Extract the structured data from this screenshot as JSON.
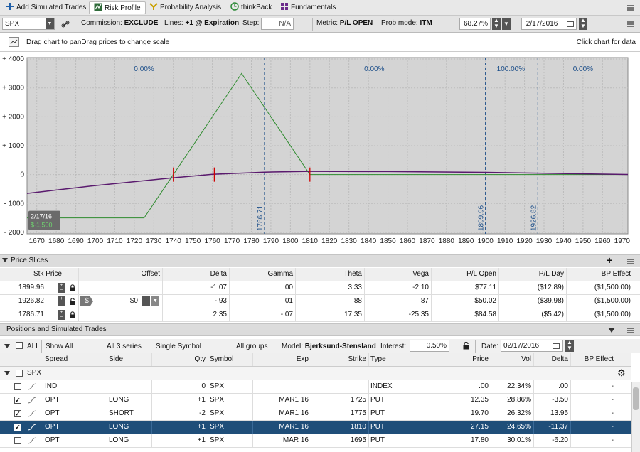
{
  "tabs": [
    {
      "label": "Add Simulated Trades",
      "icon": "plus-icon"
    },
    {
      "label": "Risk Profile",
      "icon": "risk-profile-icon",
      "active": true
    },
    {
      "label": "Probability Analysis",
      "icon": "probability-icon"
    },
    {
      "label": "thinkBack",
      "icon": "thinkback-icon"
    },
    {
      "label": "Fundamentals",
      "icon": "fundamentals-icon"
    }
  ],
  "toolbar": {
    "symbol": "SPX",
    "commission_label": "Commission:",
    "commission_value": "EXCLUDE",
    "lines_label": "Lines:",
    "lines_value": "+1 @ Expiration",
    "step_label": "Step:",
    "step_value": "N/A",
    "metric_label": "Metric:",
    "metric_value": "P/L OPEN",
    "prob_label": "Prob mode:",
    "prob_value": "ITM",
    "percent": "68.27%",
    "date": " 2/17/2016"
  },
  "infobar": {
    "left_text": "Drag chart to panDrag prices to change scale",
    "right_text": "Click chart for data"
  },
  "chart_data": {
    "type": "line",
    "xlim": [
      1665,
      1973
    ],
    "ylim": [
      -2050,
      4050
    ],
    "x_ticks": [
      1670,
      1680,
      1690,
      1700,
      1710,
      1720,
      1730,
      1740,
      1750,
      1760,
      1770,
      1780,
      1790,
      1800,
      1810,
      1820,
      1830,
      1840,
      1850,
      1860,
      1870,
      1880,
      1890,
      1900,
      1910,
      1920,
      1930,
      1940,
      1950,
      1960,
      1970
    ],
    "y_ticks": [
      {
        "v": 4000,
        "label": "+ 4000"
      },
      {
        "v": 3000,
        "label": "+ 3000"
      },
      {
        "v": 2000,
        "label": "+ 2000"
      },
      {
        "v": 1000,
        "label": "+ 1000"
      },
      {
        "v": 0,
        "label": "0"
      },
      {
        "v": -1000,
        "label": "- 1000"
      },
      {
        "v": -2000,
        "label": "- 2000"
      }
    ],
    "series": [
      {
        "color": "#2e8b2e",
        "x": [
          1665,
          1725,
          1740,
          1775,
          1810,
          1973
        ],
        "y": [
          -1500,
          -1500,
          0,
          3500,
          0,
          0
        ]
      },
      {
        "color": "#5a1a6e",
        "x": [
          1665,
          1700,
          1740,
          1760,
          1786.71,
          1810,
          1850,
          1899.96,
          1926.82,
          1973
        ],
        "y": [
          -650,
          -380,
          -110,
          10,
          85,
          110,
          105,
          77,
          50,
          5
        ]
      }
    ],
    "vlines": [
      {
        "x": 1786.71,
        "label": "1786.71"
      },
      {
        "x": 1899.96,
        "label": "1899.96"
      },
      {
        "x": 1926.82,
        "label": "1926.82"
      }
    ],
    "zone_labels": [
      {
        "x": 1725,
        "label": "0.00%"
      },
      {
        "x": 1843,
        "label": "0.00%"
      },
      {
        "x": 1913,
        "label": "100.00%"
      },
      {
        "x": 1950,
        "label": "0.00%"
      }
    ],
    "breakpoints": [
      1740,
      1761,
      1810
    ],
    "cursor_label": {
      "date": "2/17/16",
      "value": "$-1,500"
    }
  },
  "price_slices": {
    "title": "Price Slices",
    "headers": [
      "Stk Price",
      "Offset",
      "Delta",
      "Gamma",
      "Theta",
      "Vega",
      "P/L Open",
      "P/L Day",
      "BP Effect"
    ],
    "rows": [
      {
        "price": "1899.96",
        "offset": "",
        "delta": "-1.07",
        "gamma": ".00",
        "theta": "3.33",
        "vega": "-2.10",
        "plopen": "$77.11",
        "plday": "($12.89)",
        "bp": "($1,500.00)"
      },
      {
        "price": "1926.82",
        "offset": "$0",
        "delta": "-.93",
        "gamma": ".01",
        "theta": ".88",
        "vega": ".87",
        "plopen": "$50.02",
        "plday": "($39.98)",
        "bp": "($1,500.00)"
      },
      {
        "price": "1786.71",
        "offset": "",
        "delta": "2.35",
        "gamma": "-.07",
        "theta": "17.35",
        "vega": "-25.35",
        "plopen": "$84.58",
        "plday": "($5.42)",
        "bp": "($1,500.00)"
      }
    ]
  },
  "positions": {
    "title": "Positions and Simulated Trades",
    "filters": {
      "all": "ALL",
      "show": "Show All",
      "series": "All 3 series",
      "symbol": "Single Symbol",
      "groups": "All groups",
      "model_label": "Model:",
      "model_value": "Bjerksund-Stensland",
      "interest_label": "Interest:",
      "interest_value": "0.50%",
      "date_label": "Date:",
      "date_value": "02/17/2016"
    },
    "headers": [
      "Spread",
      "Side",
      "Qty",
      "Symbol",
      "Exp",
      "Strike",
      "Type",
      "Price",
      "Vol",
      "Delta",
      "BP Effect"
    ],
    "group": "SPX",
    "rows": [
      {
        "checked": false,
        "spread": "IND",
        "side": "",
        "qty": "0",
        "symbol": "SPX",
        "exp": "",
        "strike": "",
        "type": "INDEX",
        "price": ".00",
        "vol": "22.34%",
        "delta": ".00",
        "bp": "-"
      },
      {
        "checked": true,
        "spread": "OPT",
        "side": "LONG",
        "qty": "+1",
        "symbol": "SPX",
        "exp": "MAR1 16",
        "strike": "1725",
        "type": "PUT",
        "price": "12.35",
        "vol": "28.86%",
        "delta": "-3.50",
        "bp": "-"
      },
      {
        "checked": true,
        "spread": "OPT",
        "side": "SHORT",
        "qty": "-2",
        "symbol": "SPX",
        "exp": "MAR1 16",
        "strike": "1775",
        "type": "PUT",
        "price": "19.70",
        "vol": "26.32%",
        "delta": "13.95",
        "bp": "-"
      },
      {
        "checked": true,
        "selected": true,
        "spread": "OPT",
        "side": "LONG",
        "qty": "+1",
        "symbol": "SPX",
        "exp": "MAR1 16",
        "strike": "1810",
        "type": "PUT",
        "price": "27.15",
        "vol": "24.65%",
        "delta": "-11.37",
        "bp": "-"
      },
      {
        "checked": false,
        "spread": "OPT",
        "side": "LONG",
        "qty": "+1",
        "symbol": "SPX",
        "exp": "MAR 16",
        "strike": "1695",
        "type": "PUT",
        "price": "17.80",
        "vol": "30.01%",
        "delta": "-6.20",
        "bp": "-"
      }
    ]
  }
}
